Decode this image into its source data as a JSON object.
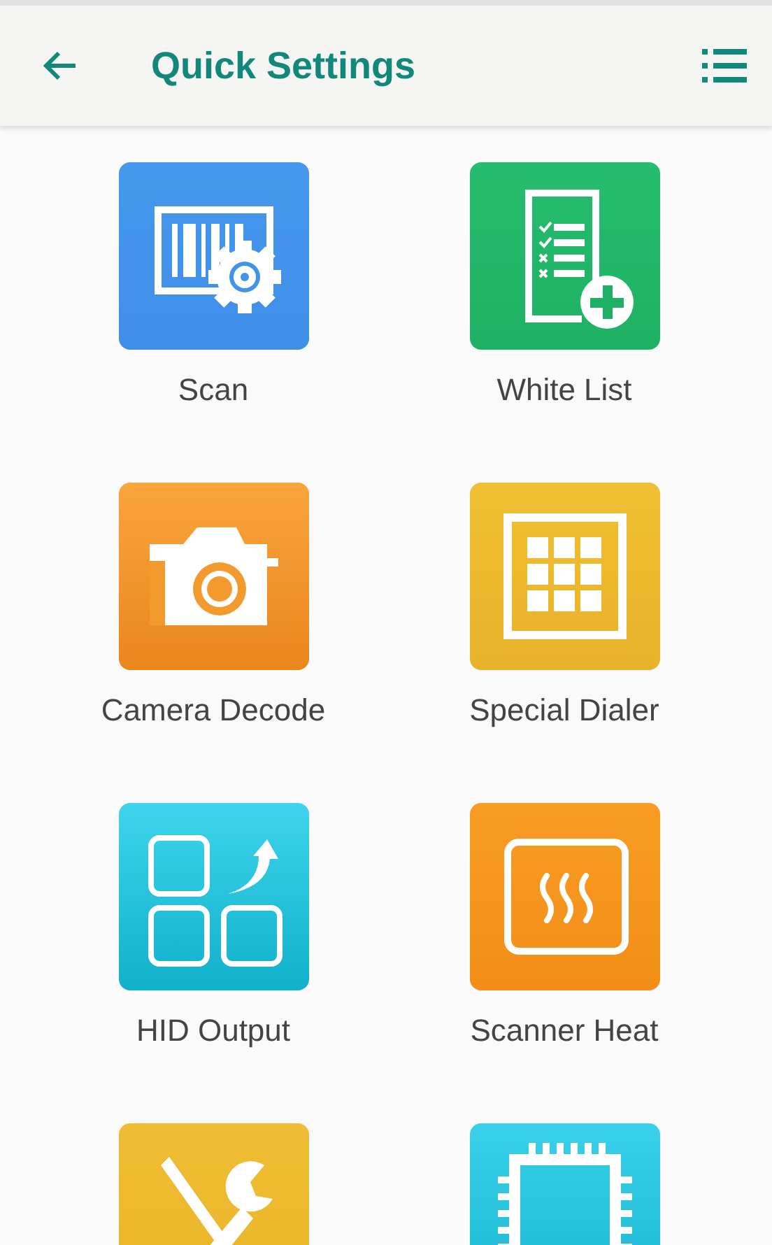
{
  "app_bar": {
    "title": "Quick Settings"
  },
  "items": [
    {
      "kind": "scan",
      "label": "Scan"
    },
    {
      "kind": "white_list",
      "label": "White List"
    },
    {
      "kind": "camera",
      "label": "Camera Decode"
    },
    {
      "kind": "dialer",
      "label": "Special Dialer"
    },
    {
      "kind": "hid",
      "label": "HID Output"
    },
    {
      "kind": "heat",
      "label": "Scanner Heat"
    },
    {
      "kind": "tools"
    },
    {
      "kind": "chip"
    }
  ]
}
